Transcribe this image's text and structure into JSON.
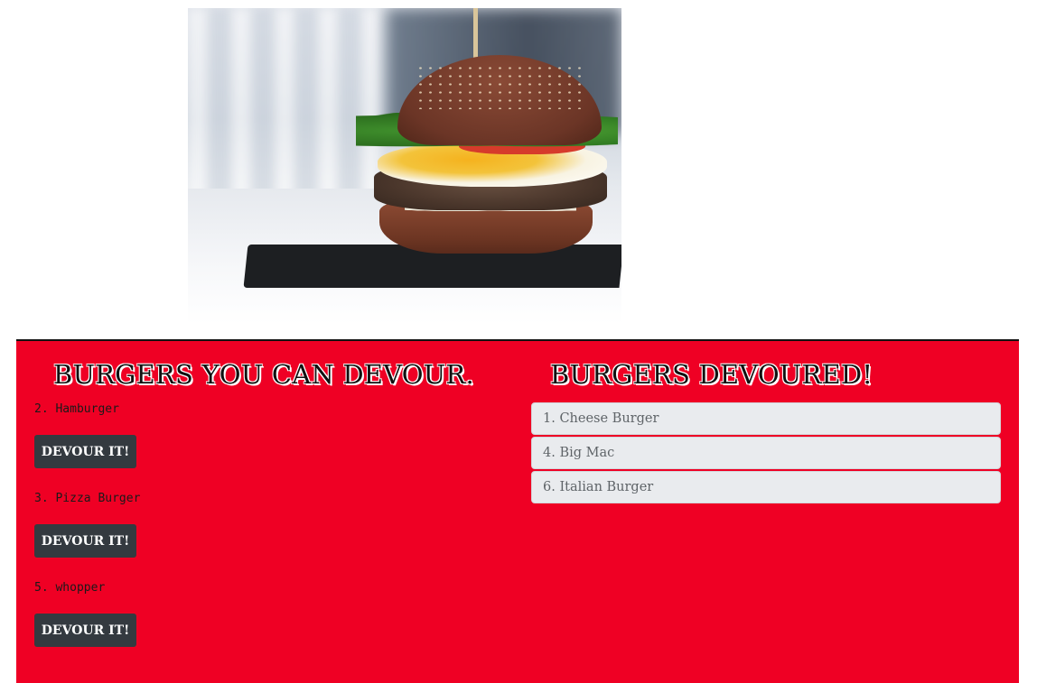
{
  "hero": {
    "image_alt": "burger-photo"
  },
  "left_column": {
    "heading": "BURGERS YOU CAN DEVOUR.",
    "items": [
      {
        "name": "2. Hamburger",
        "button_label": "DEVOUR IT!"
      },
      {
        "name": "3. Pizza Burger",
        "button_label": "DEVOUR IT!"
      },
      {
        "name": "5. whopper",
        "button_label": "DEVOUR IT!"
      }
    ]
  },
  "right_column": {
    "heading": "BURGERS DEVOURED!",
    "items": [
      {
        "label": "1. Cheese Burger"
      },
      {
        "label": "4. Big Mac"
      },
      {
        "label": "6. Italian Burger"
      }
    ]
  },
  "colors": {
    "panel_background": "#ef0024",
    "button_background": "#343a40",
    "list_item_background": "#e9ebee"
  }
}
